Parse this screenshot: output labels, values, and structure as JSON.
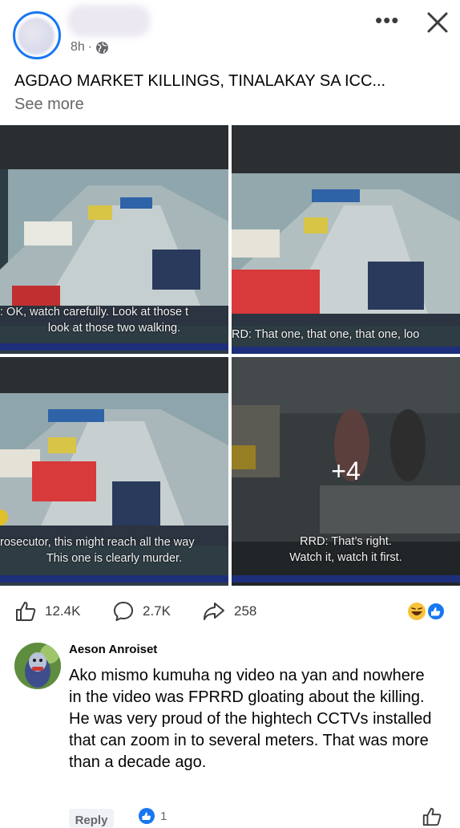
{
  "post": {
    "time": "8h",
    "title": "AGDAO MARKET KILLINGS, TINALAKAY SA ICC...",
    "see_more": "See more"
  },
  "media": {
    "tile1_caption_1": ": OK, watch carefully.  Look at those t",
    "tile1_caption_2": "look at those two walking.",
    "tile2_caption": "RD: That one, that one, that one, loo",
    "tile3_caption_1": "rosecutor, this might reach all the way",
    "tile3_caption_2": "This one is clearly murder.",
    "tile4_caption_1": "RRD: That’s right.",
    "tile4_caption_2": "Watch it, watch it first.",
    "more_count": "+4"
  },
  "actions": {
    "likes": "12.4K",
    "comments": "2.7K",
    "shares": "258"
  },
  "comment": {
    "author": "Aeson Anroiset",
    "text": "Ako mismo kumuha ng video na yan and nowhere in the video was FPRRD gloating about the killing. He was very proud of the hightech CCTVs installed that can zoom in to several meters. That was more than a decade ago.",
    "reply_label": "Reply",
    "like_count": "1"
  },
  "colors": {
    "accent": "#1877f2",
    "secondary_text": "#65676b"
  },
  "icons": [
    "globe-icon",
    "more-options-icon",
    "close-icon",
    "like-icon",
    "comment-icon",
    "share-icon",
    "haha-reaction-icon",
    "like-reaction-icon"
  ]
}
